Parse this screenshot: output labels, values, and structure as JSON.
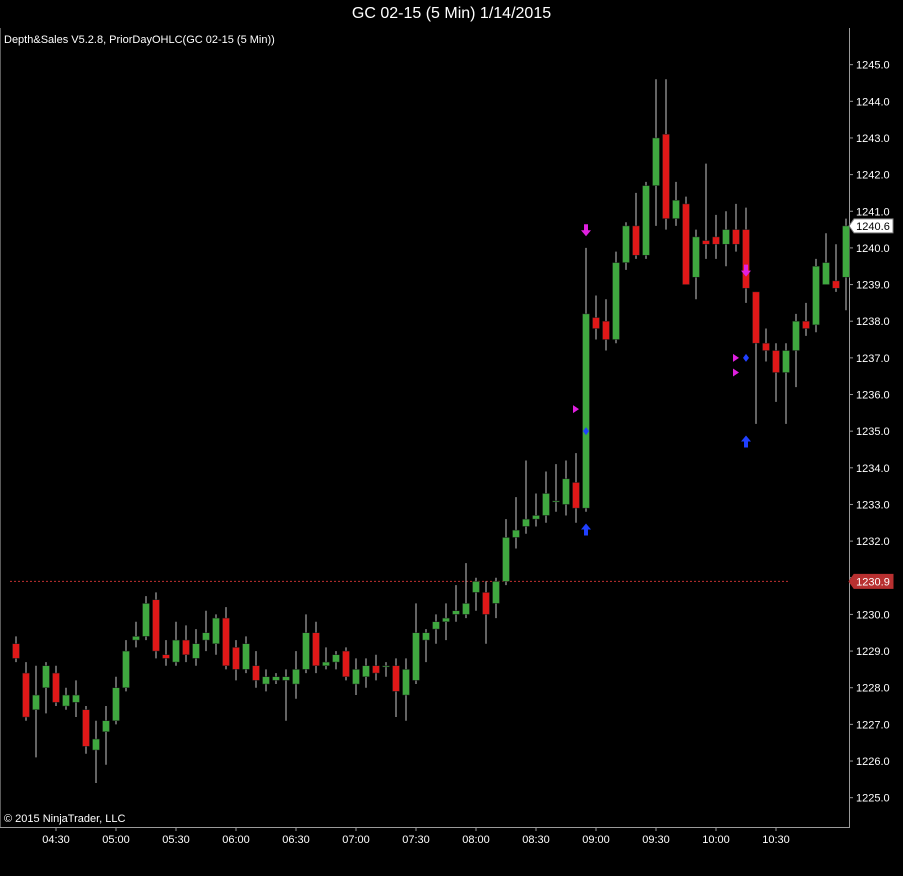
{
  "window": {
    "title": "GC 02-15 (5 Min)  1/14/2015"
  },
  "chart_data": {
    "type": "candlestick",
    "indicator_label": "Depth&Sales V5.2.8, PriorDayOHLC(GC 02-15 (5 Min))",
    "copyright": "© 2015 NinjaTrader, LLC",
    "ylim": [
      1224.2,
      1246.0
    ],
    "y_ticks": [
      1225.0,
      1226.0,
      1227.0,
      1228.0,
      1229.0,
      1230.0,
      1231.0,
      1232.0,
      1233.0,
      1234.0,
      1235.0,
      1236.0,
      1237.0,
      1238.0,
      1239.0,
      1240.0,
      1241.0,
      1242.0,
      1243.0,
      1244.0,
      1245.0
    ],
    "x_ticks": [
      {
        "label": "04:30",
        "bar": 4
      },
      {
        "label": "05:00",
        "bar": 10
      },
      {
        "label": "05:30",
        "bar": 16
      },
      {
        "label": "06:00",
        "bar": 22
      },
      {
        "label": "06:30",
        "bar": 28
      },
      {
        "label": "07:00",
        "bar": 34
      },
      {
        "label": "07:30",
        "bar": 40
      },
      {
        "label": "08:00",
        "bar": 46
      },
      {
        "label": "08:30",
        "bar": 52
      },
      {
        "label": "09:00",
        "bar": 58
      },
      {
        "label": "09:30",
        "bar": 64
      },
      {
        "label": "10:00",
        "bar": 70
      },
      {
        "label": "10:30",
        "bar": 76
      }
    ],
    "last_price": 1240.6,
    "prior_day_level": 1230.9,
    "colors": {
      "up": "#3fa83f",
      "down": "#e01818",
      "wick": "#c8c8c8",
      "prior_line": "#c03030",
      "signal_down": "#e020e0",
      "signal_up": "#2040ff"
    },
    "candles": [
      {
        "o": 1229.2,
        "h": 1229.4,
        "l": 1228.7,
        "c": 1228.8
      },
      {
        "o": 1228.4,
        "h": 1228.7,
        "l": 1227.1,
        "c": 1227.2
      },
      {
        "o": 1227.4,
        "h": 1228.6,
        "l": 1226.1,
        "c": 1227.8
      },
      {
        "o": 1228.0,
        "h": 1228.7,
        "l": 1227.3,
        "c": 1228.6
      },
      {
        "o": 1228.4,
        "h": 1228.6,
        "l": 1227.5,
        "c": 1227.6
      },
      {
        "o": 1227.5,
        "h": 1228.0,
        "l": 1227.4,
        "c": 1227.8
      },
      {
        "o": 1227.6,
        "h": 1228.2,
        "l": 1227.2,
        "c": 1227.8
      },
      {
        "o": 1227.4,
        "h": 1227.5,
        "l": 1226.2,
        "c": 1226.4
      },
      {
        "o": 1226.3,
        "h": 1227.1,
        "l": 1225.4,
        "c": 1226.6
      },
      {
        "o": 1226.8,
        "h": 1227.5,
        "l": 1225.9,
        "c": 1227.1
      },
      {
        "o": 1227.1,
        "h": 1228.3,
        "l": 1227.0,
        "c": 1228.0
      },
      {
        "o": 1228.0,
        "h": 1229.3,
        "l": 1227.9,
        "c": 1229.0
      },
      {
        "o": 1229.3,
        "h": 1229.8,
        "l": 1229.1,
        "c": 1229.4
      },
      {
        "o": 1229.4,
        "h": 1230.5,
        "l": 1229.3,
        "c": 1230.3
      },
      {
        "o": 1230.4,
        "h": 1230.6,
        "l": 1228.8,
        "c": 1229.0
      },
      {
        "o": 1228.9,
        "h": 1229.3,
        "l": 1228.6,
        "c": 1228.8
      },
      {
        "o": 1228.7,
        "h": 1229.8,
        "l": 1228.6,
        "c": 1229.3
      },
      {
        "o": 1229.3,
        "h": 1229.7,
        "l": 1228.7,
        "c": 1228.9
      },
      {
        "o": 1228.8,
        "h": 1229.6,
        "l": 1228.6,
        "c": 1229.2
      },
      {
        "o": 1229.3,
        "h": 1230.1,
        "l": 1229.0,
        "c": 1229.5
      },
      {
        "o": 1229.2,
        "h": 1230.0,
        "l": 1228.9,
        "c": 1229.9
      },
      {
        "o": 1229.9,
        "h": 1230.2,
        "l": 1228.5,
        "c": 1228.6
      },
      {
        "o": 1229.1,
        "h": 1229.3,
        "l": 1228.2,
        "c": 1228.5
      },
      {
        "o": 1228.5,
        "h": 1229.4,
        "l": 1228.4,
        "c": 1229.2
      },
      {
        "o": 1228.6,
        "h": 1229.0,
        "l": 1228.0,
        "c": 1228.2
      },
      {
        "o": 1228.1,
        "h": 1228.5,
        "l": 1227.9,
        "c": 1228.3
      },
      {
        "o": 1228.2,
        "h": 1228.4,
        "l": 1228.1,
        "c": 1228.3
      },
      {
        "o": 1228.2,
        "h": 1228.5,
        "l": 1227.1,
        "c": 1228.3
      },
      {
        "o": 1228.1,
        "h": 1229.0,
        "l": 1227.7,
        "c": 1228.5
      },
      {
        "o": 1228.5,
        "h": 1230.0,
        "l": 1228.4,
        "c": 1229.5
      },
      {
        "o": 1229.5,
        "h": 1229.8,
        "l": 1228.4,
        "c": 1228.6
      },
      {
        "o": 1228.6,
        "h": 1229.1,
        "l": 1228.5,
        "c": 1228.7
      },
      {
        "o": 1228.7,
        "h": 1229.0,
        "l": 1228.5,
        "c": 1228.9
      },
      {
        "o": 1229.0,
        "h": 1229.1,
        "l": 1228.2,
        "c": 1228.3
      },
      {
        "o": 1228.1,
        "h": 1228.8,
        "l": 1227.8,
        "c": 1228.5
      },
      {
        "o": 1228.3,
        "h": 1228.8,
        "l": 1228.0,
        "c": 1228.6
      },
      {
        "o": 1228.6,
        "h": 1228.9,
        "l": 1228.2,
        "c": 1228.4
      },
      {
        "o": 1228.6,
        "h": 1228.7,
        "l": 1228.3,
        "c": 1228.6
      },
      {
        "o": 1228.6,
        "h": 1228.8,
        "l": 1227.2,
        "c": 1227.9
      },
      {
        "o": 1227.8,
        "h": 1228.8,
        "l": 1227.1,
        "c": 1228.5
      },
      {
        "o": 1228.2,
        "h": 1230.3,
        "l": 1228.1,
        "c": 1229.5
      },
      {
        "o": 1229.3,
        "h": 1229.6,
        "l": 1228.7,
        "c": 1229.5
      },
      {
        "o": 1229.6,
        "h": 1230.0,
        "l": 1229.2,
        "c": 1229.8
      },
      {
        "o": 1229.8,
        "h": 1230.3,
        "l": 1229.3,
        "c": 1229.9
      },
      {
        "o": 1230.0,
        "h": 1230.8,
        "l": 1229.8,
        "c": 1230.1
      },
      {
        "o": 1230.0,
        "h": 1231.4,
        "l": 1229.9,
        "c": 1230.3
      },
      {
        "o": 1230.6,
        "h": 1231.0,
        "l": 1230.1,
        "c": 1230.9
      },
      {
        "o": 1230.6,
        "h": 1230.9,
        "l": 1229.2,
        "c": 1230.0
      },
      {
        "o": 1230.3,
        "h": 1231.0,
        "l": 1229.9,
        "c": 1230.9
      },
      {
        "o": 1230.9,
        "h": 1232.6,
        "l": 1230.8,
        "c": 1232.1
      },
      {
        "o": 1232.1,
        "h": 1233.2,
        "l": 1231.8,
        "c": 1232.3
      },
      {
        "o": 1232.4,
        "h": 1234.2,
        "l": 1232.2,
        "c": 1232.6
      },
      {
        "o": 1232.6,
        "h": 1233.3,
        "l": 1232.4,
        "c": 1232.7
      },
      {
        "o": 1232.7,
        "h": 1233.9,
        "l": 1232.5,
        "c": 1233.3
      },
      {
        "o": 1233.1,
        "h": 1234.1,
        "l": 1232.8,
        "c": 1233.1
      },
      {
        "o": 1233.0,
        "h": 1234.2,
        "l": 1232.7,
        "c": 1233.7
      },
      {
        "o": 1233.6,
        "h": 1234.4,
        "l": 1232.5,
        "c": 1232.9
      },
      {
        "o": 1232.9,
        "h": 1240.0,
        "l": 1232.8,
        "c": 1238.2
      },
      {
        "o": 1238.1,
        "h": 1238.7,
        "l": 1237.5,
        "c": 1237.8
      },
      {
        "o": 1238.0,
        "h": 1238.6,
        "l": 1237.2,
        "c": 1237.5
      },
      {
        "o": 1237.5,
        "h": 1239.9,
        "l": 1237.4,
        "c": 1239.6
      },
      {
        "o": 1239.6,
        "h": 1240.7,
        "l": 1239.4,
        "c": 1240.6
      },
      {
        "o": 1240.6,
        "h": 1241.5,
        "l": 1239.7,
        "c": 1239.8
      },
      {
        "o": 1239.8,
        "h": 1241.8,
        "l": 1239.7,
        "c": 1241.7
      },
      {
        "o": 1241.7,
        "h": 1244.6,
        "l": 1240.6,
        "c": 1243.0
      },
      {
        "o": 1243.1,
        "h": 1244.6,
        "l": 1240.5,
        "c": 1240.8
      },
      {
        "o": 1240.8,
        "h": 1241.8,
        "l": 1240.6,
        "c": 1241.3
      },
      {
        "o": 1241.2,
        "h": 1241.4,
        "l": 1239.0,
        "c": 1239.0
      },
      {
        "o": 1239.2,
        "h": 1240.5,
        "l": 1238.6,
        "c": 1240.3
      },
      {
        "o": 1240.2,
        "h": 1242.3,
        "l": 1239.7,
        "c": 1240.1
      },
      {
        "o": 1240.3,
        "h": 1240.9,
        "l": 1239.7,
        "c": 1240.1
      },
      {
        "o": 1240.1,
        "h": 1241.0,
        "l": 1239.5,
        "c": 1240.5
      },
      {
        "o": 1240.5,
        "h": 1241.2,
        "l": 1239.9,
        "c": 1240.1
      },
      {
        "o": 1240.5,
        "h": 1241.1,
        "l": 1238.5,
        "c": 1238.9
      },
      {
        "o": 1238.8,
        "h": 1238.8,
        "l": 1235.2,
        "c": 1237.4
      },
      {
        "o": 1237.4,
        "h": 1237.8,
        "l": 1236.9,
        "c": 1237.2
      },
      {
        "o": 1237.2,
        "h": 1237.4,
        "l": 1235.8,
        "c": 1236.6
      },
      {
        "o": 1236.6,
        "h": 1237.4,
        "l": 1235.2,
        "c": 1237.2
      },
      {
        "o": 1237.2,
        "h": 1238.2,
        "l": 1236.2,
        "c": 1238.0
      },
      {
        "o": 1238.0,
        "h": 1238.5,
        "l": 1237.6,
        "c": 1237.8
      },
      {
        "o": 1237.9,
        "h": 1239.7,
        "l": 1237.7,
        "c": 1239.5
      },
      {
        "o": 1239.0,
        "h": 1240.4,
        "l": 1239.0,
        "c": 1239.6
      },
      {
        "o": 1239.1,
        "h": 1240.1,
        "l": 1238.8,
        "c": 1238.9
      },
      {
        "o": 1239.2,
        "h": 1240.8,
        "l": 1238.3,
        "c": 1240.6
      }
    ],
    "markers": [
      {
        "bar": 57,
        "price": 1240.4,
        "shape": "arrow-down",
        "color": "#e020e0"
      },
      {
        "bar": 57,
        "price": 1232.4,
        "shape": "arrow-up",
        "color": "#2040ff"
      },
      {
        "bar": 56,
        "price": 1235.6,
        "shape": "triangle-right",
        "color": "#e020e0"
      },
      {
        "bar": 57,
        "price": 1235.0,
        "shape": "diamond",
        "color": "#2040ff"
      },
      {
        "bar": 73,
        "price": 1239.3,
        "shape": "arrow-down",
        "color": "#e020e0"
      },
      {
        "bar": 73,
        "price": 1234.8,
        "shape": "arrow-up",
        "color": "#2040ff"
      },
      {
        "bar": 72,
        "price": 1237.0,
        "shape": "triangle-right",
        "color": "#e020e0"
      },
      {
        "bar": 72,
        "price": 1236.6,
        "shape": "triangle-right",
        "color": "#e020e0"
      },
      {
        "bar": 73,
        "price": 1237.0,
        "shape": "diamond",
        "color": "#2040ff"
      }
    ]
  }
}
